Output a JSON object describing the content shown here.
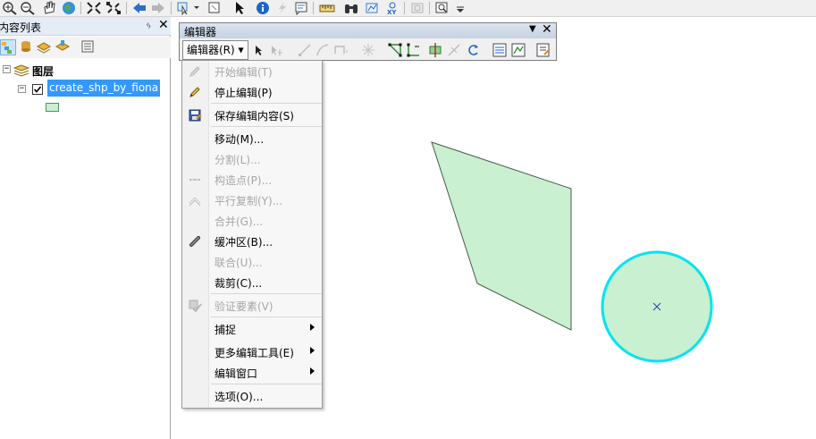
{
  "toc": {
    "title": "内容列表",
    "pin_glyph": "ᛃ",
    "close_glyph": "✕",
    "tree": {
      "root_label": "图层",
      "layer_name": "create_shp_by_fiona",
      "layer_checked": true,
      "layer_fill_color": "#c9f0d0"
    }
  },
  "editor_toolbar": {
    "title": "编辑器",
    "dropdown_label": "编辑器(R)",
    "close_glyph": "✕"
  },
  "editor_menu": {
    "items": [
      {
        "label": "开始编辑(T)",
        "enabled": false,
        "icon": "pencil-icon"
      },
      {
        "label": "停止编辑(P)",
        "enabled": true,
        "icon": "stop-edit-pencil-icon"
      },
      {
        "label": "保存编辑内容(S)",
        "enabled": true,
        "icon": "save-edits-icon"
      },
      {
        "label": "移动(M)...",
        "enabled": true,
        "icon": ""
      },
      {
        "label": "分割(L)...",
        "enabled": false,
        "icon": ""
      },
      {
        "label": "构造点(P)...",
        "enabled": false,
        "icon": "construct-points-icon"
      },
      {
        "label": "平行复制(Y)...",
        "enabled": false,
        "icon": "copy-parallel-icon"
      },
      {
        "label": "合并(G)...",
        "enabled": false,
        "icon": ""
      },
      {
        "label": "缓冲区(B)...",
        "enabled": true,
        "icon": "buffer-icon"
      },
      {
        "label": "联合(U)...",
        "enabled": false,
        "icon": ""
      },
      {
        "label": "裁剪(C)...",
        "enabled": true,
        "icon": ""
      },
      {
        "label": "验证要素(V)",
        "enabled": false,
        "icon": "validate-features-icon"
      },
      {
        "label": "捕捉",
        "enabled": true,
        "icon": "",
        "submenu": true
      },
      {
        "label": "更多编辑工具(E)",
        "enabled": true,
        "icon": "",
        "submenu": true
      },
      {
        "label": "编辑窗口",
        "enabled": true,
        "icon": "",
        "submenu": true
      },
      {
        "label": "选项(O)...",
        "enabled": true,
        "icon": ""
      }
    ]
  },
  "map": {
    "polygon_fill": "#c9f0d0",
    "polygon_stroke": "#4a5a4a",
    "circle_fill": "#c9f0d0",
    "circle_stroke": "#00e5ee",
    "center_marker_color": "#3040a0"
  },
  "colors": {
    "selection_blue": "#3399ff",
    "title_bar": "#dbe4ef"
  }
}
